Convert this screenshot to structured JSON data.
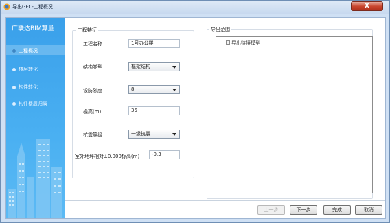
{
  "window": {
    "title": "导出GFC-工程概况",
    "close_label": "X"
  },
  "sidebar": {
    "title": "广联达BIM算量",
    "steps": [
      {
        "label": "工程概况",
        "active": true
      },
      {
        "label": "楼层转化",
        "active": false
      },
      {
        "label": "构件转化",
        "active": false
      },
      {
        "label": "构件楼层归属",
        "active": false
      }
    ]
  },
  "project": {
    "group_title": "工程特征",
    "name_label": "工程名称",
    "name_value": "1号办公楼",
    "structure_label": "结构类型",
    "structure_value": "框架结构",
    "intensity_label": "设防烈度",
    "intensity_value": "8",
    "height_label": "檐高(m)",
    "height_value": "35",
    "seismic_label": "抗震等级",
    "seismic_value": "一级抗震",
    "elevation_label": "室外地坪相对±0.000标高(m)",
    "elevation_value": "-0.3"
  },
  "export_scope": {
    "group_title": "导出范围",
    "tree_item": "导出链接模型"
  },
  "buttons": {
    "prev": "上一步",
    "next": "下一步",
    "finish": "完成",
    "cancel": "取消"
  }
}
